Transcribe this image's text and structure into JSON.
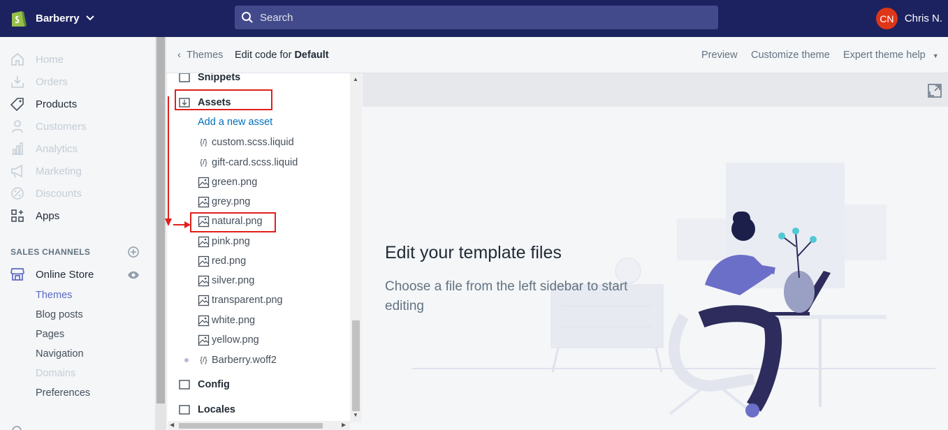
{
  "topbar": {
    "store_name": "Barberry",
    "search_placeholder": "Search",
    "user_initials": "CN",
    "user_name": "Chris N."
  },
  "sidebar": {
    "items": [
      {
        "label": "Home",
        "icon": "home-icon",
        "state": "disabled"
      },
      {
        "label": "Orders",
        "icon": "orders-icon",
        "state": "disabled"
      },
      {
        "label": "Products",
        "icon": "tag-icon",
        "state": "normal"
      },
      {
        "label": "Customers",
        "icon": "person-icon",
        "state": "disabled"
      },
      {
        "label": "Analytics",
        "icon": "bar-chart-icon",
        "state": "disabled"
      },
      {
        "label": "Marketing",
        "icon": "megaphone-icon",
        "state": "disabled"
      },
      {
        "label": "Discounts",
        "icon": "discount-icon",
        "state": "disabled"
      },
      {
        "label": "Apps",
        "icon": "apps-icon",
        "state": "normal"
      }
    ],
    "sales_channels_title": "SALES CHANNELS",
    "online_store": "Online Store",
    "sub_items": [
      {
        "label": "Themes",
        "state": "active"
      },
      {
        "label": "Blog posts",
        "state": "normal"
      },
      {
        "label": "Pages",
        "state": "normal"
      },
      {
        "label": "Navigation",
        "state": "normal"
      },
      {
        "label": "Domains",
        "state": "disabled"
      },
      {
        "label": "Preferences",
        "state": "normal"
      }
    ]
  },
  "header": {
    "back_label": "Themes",
    "title_prefix": "Edit code for",
    "title_theme": "Default",
    "preview": "Preview",
    "customize": "Customize theme",
    "expert_help": "Expert theme help"
  },
  "tree": {
    "snippets": "Snippets",
    "assets": "Assets",
    "add_asset": "Add a new asset",
    "files": [
      {
        "name": "custom.scss.liquid",
        "kind": "code"
      },
      {
        "name": "gift-card.scss.liquid",
        "kind": "code"
      },
      {
        "name": "green.png",
        "kind": "image"
      },
      {
        "name": "grey.png",
        "kind": "image"
      },
      {
        "name": "natural.png",
        "kind": "image"
      },
      {
        "name": "pink.png",
        "kind": "image"
      },
      {
        "name": "red.png",
        "kind": "image"
      },
      {
        "name": "silver.png",
        "kind": "image"
      },
      {
        "name": "transparent.png",
        "kind": "image"
      },
      {
        "name": "white.png",
        "kind": "image"
      },
      {
        "name": "yellow.png",
        "kind": "image"
      },
      {
        "name": "Barberry.woff2",
        "kind": "code"
      }
    ],
    "config": "Config",
    "locales": "Locales"
  },
  "editor": {
    "empty_title": "Edit your template files",
    "empty_subtitle": "Choose a file from the left sidebar to start editing"
  },
  "colors": {
    "topbar": "#1c2260",
    "accent": "#5c6ac4",
    "link": "#006fbb",
    "annotation": "#e0201c"
  }
}
